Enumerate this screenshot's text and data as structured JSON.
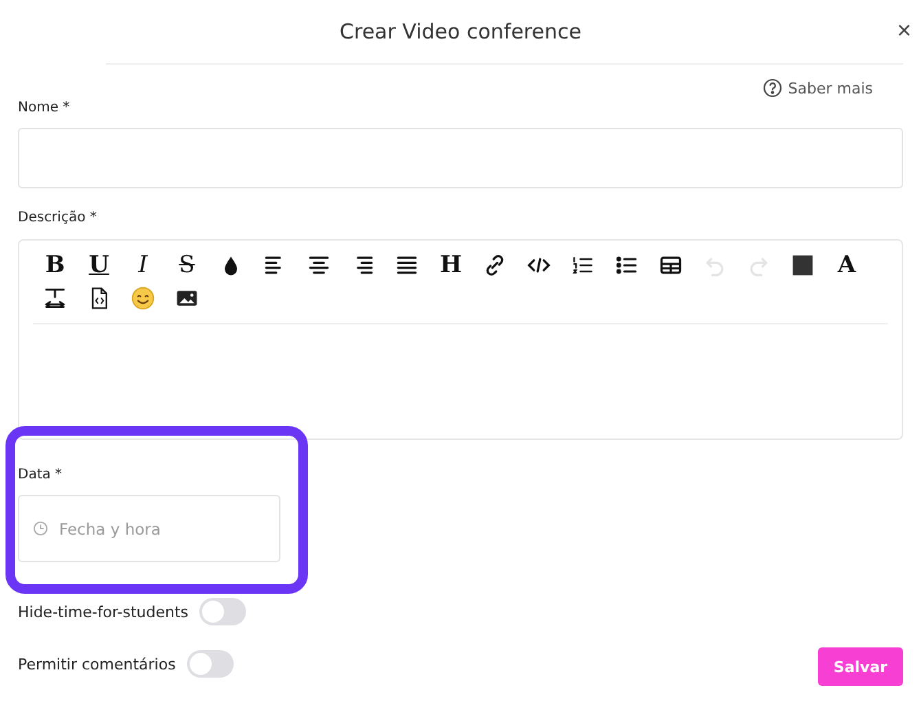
{
  "dialog": {
    "title": "Crear Video conference",
    "close": "×",
    "help_link": "Saber mais"
  },
  "fields": [
    {
      "label": "Nome *"
    }
  ],
  "editor": {
    "label": "Descrição *",
    "toolbar": [
      {
        "kind": "bold",
        "label": "B",
        "disabled": false
      },
      {
        "kind": "underline",
        "label": "U",
        "disabled": false
      },
      {
        "kind": "italic",
        "label": "I",
        "disabled": false
      },
      {
        "kind": "strike",
        "label": "S",
        "disabled": false
      },
      {
        "kind": "drop",
        "disabled": false
      },
      {
        "kind": "align-left",
        "disabled": false
      },
      {
        "kind": "align-center",
        "disabled": false
      },
      {
        "kind": "align-right",
        "disabled": false
      },
      {
        "kind": "justify",
        "disabled": false
      },
      {
        "kind": "heading",
        "label": "H",
        "disabled": false
      },
      {
        "kind": "link",
        "disabled": false
      },
      {
        "kind": "code",
        "disabled": false
      },
      {
        "kind": "ordered-list",
        "disabled": false
      },
      {
        "kind": "bullet-list",
        "disabled": false
      },
      {
        "kind": "table",
        "disabled": false
      },
      {
        "kind": "undo",
        "disabled": true
      },
      {
        "kind": "redo",
        "disabled": true
      },
      {
        "kind": "color",
        "disabled": false
      },
      {
        "kind": "font",
        "label": "A",
        "disabled": false
      },
      {
        "kind": "line-height",
        "disabled": false
      },
      {
        "kind": "file-code",
        "disabled": false
      },
      {
        "kind": "emoji",
        "disabled": false
      },
      {
        "kind": "image",
        "disabled": false
      }
    ]
  },
  "date": {
    "label": "Data *",
    "placeholder": "Fecha y hora",
    "highlighted": true
  },
  "toggles": [
    {
      "label": "Hide-time-for-students",
      "on": false
    },
    {
      "label": "Permitir comentários",
      "on": false
    }
  ],
  "save_button": "Salvar"
}
